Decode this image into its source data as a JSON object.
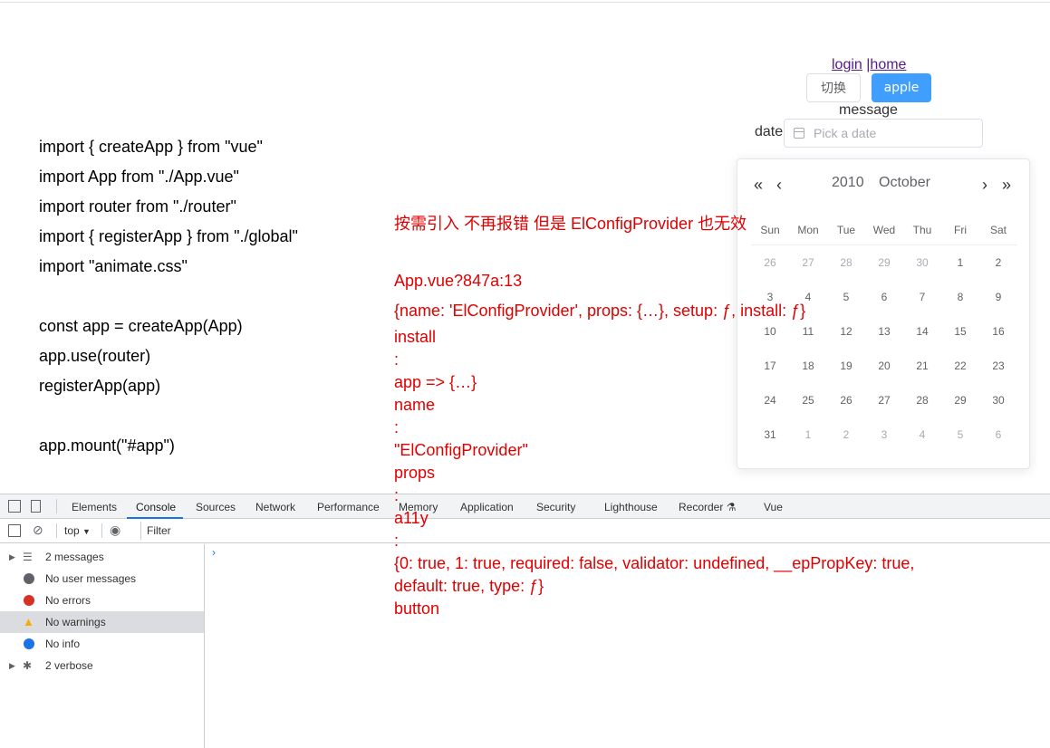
{
  "nav": {
    "login": "login",
    "sep": " |",
    "home": "home"
  },
  "buttons": {
    "toggle": "切换",
    "apple": "apple"
  },
  "message_label": "message",
  "date_label": "date",
  "date_placeholder": "Pick a date",
  "calendar": {
    "prev_year": "«",
    "prev_month": "‹",
    "next_month": "›",
    "next_year": "»",
    "year": "2010",
    "month": "October",
    "weekdays": [
      "Sun",
      "Mon",
      "Tue",
      "Wed",
      "Thu",
      "Fri",
      "Sat"
    ],
    "rows": [
      [
        "26",
        "27",
        "28",
        "29",
        "30",
        "1",
        "2"
      ],
      [
        "3",
        "4",
        "5",
        "6",
        "7",
        "8",
        "9"
      ],
      [
        "10",
        "11",
        "12",
        "13",
        "14",
        "15",
        "16"
      ],
      [
        "17",
        "18",
        "19",
        "20",
        "21",
        "22",
        "23"
      ],
      [
        "24",
        "25",
        "26",
        "27",
        "28",
        "29",
        "30"
      ],
      [
        "31",
        "1",
        "2",
        "3",
        "4",
        "5",
        "6"
      ]
    ]
  },
  "code": {
    "l1": "import { createApp } from \"vue\"",
    "l2": "import App from \"./App.vue\"",
    "l3": "import router from \"./router\"",
    "l4": "import { registerApp } from \"./global\"",
    "l5": "import \"animate.css\"",
    "l6": "const app = createApp(App)",
    "l7": "app.use(router)",
    "l8": "registerApp(app)",
    "l9": "app.mount(\"#app\")"
  },
  "annotation": {
    "title": "按需引入 不再报错 但是 ElConfigProvider 也无效",
    "a1": "App.vue?847a:13",
    "a2": "{name: 'ElConfigProvider', props: {…}, setup: ƒ, install: ƒ}",
    "a3": "install",
    "a4": ":",
    "a5": "app => {…}",
    "a6": "name",
    "a7": ":",
    "a8": "\"ElConfigProvider\"",
    "a9": "props",
    "a10": ":",
    "a11": "a11y",
    "a12": ":",
    "a13": "{0: true, 1: true, required: false, validator: undefined, __epPropKey: true,",
    "a14": "default: true, type: ƒ}",
    "a15": "button"
  },
  "devtools": {
    "tabs": [
      "Elements",
      "Console",
      "Sources",
      "Network",
      "Performance",
      "Memory",
      "Application",
      "Security",
      "Lighthouse",
      "Recorder",
      "Vue"
    ],
    "context": "top",
    "filter_placeholder": "Filter",
    "sidebar": [
      {
        "label": "2 messages"
      },
      {
        "label": "No user messages"
      },
      {
        "label": "No errors"
      },
      {
        "label": "No warnings"
      },
      {
        "label": "No info"
      },
      {
        "label": "2 verbose"
      }
    ],
    "prompt": "›"
  },
  "colors": {
    "primary": "#409eff",
    "error": "#e00000",
    "warning": "#f9ab00",
    "info": "#1a73e8"
  }
}
